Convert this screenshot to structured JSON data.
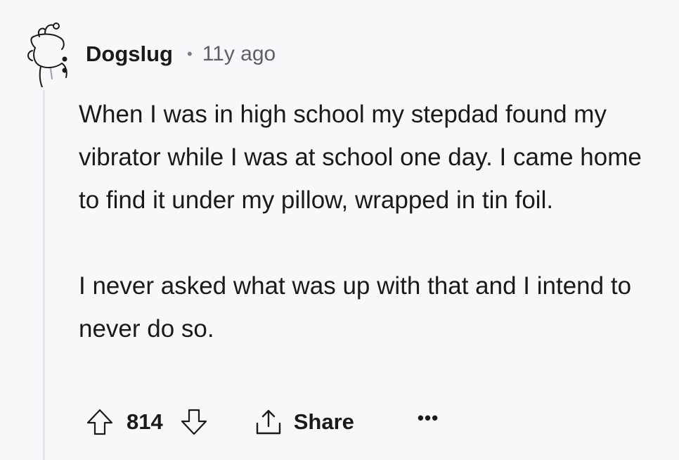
{
  "comment": {
    "author": "Dogslug",
    "separator": "•",
    "timestamp": "11y ago",
    "avatar_icon": "reddit-snoo-avatar-icon",
    "paragraphs": [
      "When I was in high school my stepdad found my vibrator while I was at school one day. I came home to find it under my pillow, wrapped in tin foil.",
      "I never asked what was up with that and I intend to never do so."
    ]
  },
  "actions": {
    "upvote_icon": "arrow-up-icon",
    "vote_count": "814",
    "downvote_icon": "arrow-down-icon",
    "share_icon": "share-icon",
    "share_label": "Share",
    "more_label": "•••"
  },
  "colors": {
    "background": "#f8f8fa",
    "text": "#1a1a1b",
    "muted": "#5c6166",
    "thread_line": "#e2e5ea"
  }
}
